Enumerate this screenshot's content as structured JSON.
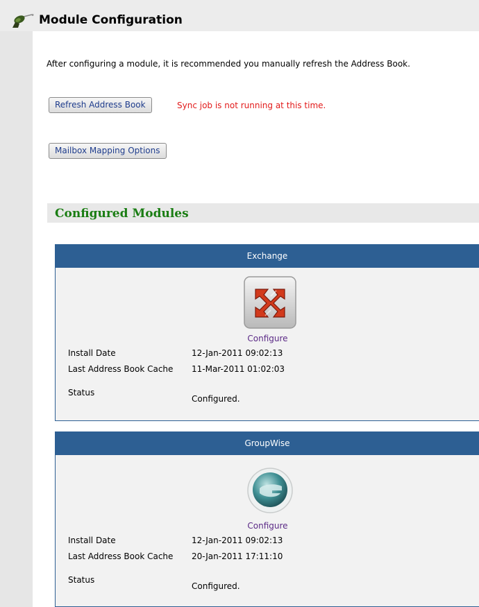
{
  "header": {
    "title": "Module Configuration",
    "icon": "satellite-dish-icon"
  },
  "intro": {
    "text": "After configuring a module, it is recommended you manually refresh the Address Book."
  },
  "actions": {
    "refresh_label": "Refresh Address Book",
    "sync_status": "Sync job is not running at this time.",
    "mailbox_label": "Mailbox Mapping Options"
  },
  "section": {
    "title": "Configured Modules"
  },
  "field_labels": {
    "install_date": "Install Date",
    "last_cache": "Last Address Book Cache",
    "status": "Status"
  },
  "modules": [
    {
      "name": "Exchange",
      "icon": "exchange-logo-icon",
      "configure_label": "Configure",
      "install_date": "12-Jan-2011 09:02:13",
      "last_cache": "11-Mar-2011 01:02:03",
      "status": "Configured."
    },
    {
      "name": "GroupWise",
      "icon": "groupwise-logo-icon",
      "configure_label": "Configure",
      "install_date": "12-Jan-2011 09:02:13",
      "last_cache": "20-Jan-2011 17:11:10",
      "status": "Configured."
    }
  ],
  "colors": {
    "card_header": "#2d5f93",
    "section_title": "#1a7d13",
    "error_text": "#e21a1a",
    "link": "#5b2a86",
    "button_text": "#1e3c8c"
  }
}
